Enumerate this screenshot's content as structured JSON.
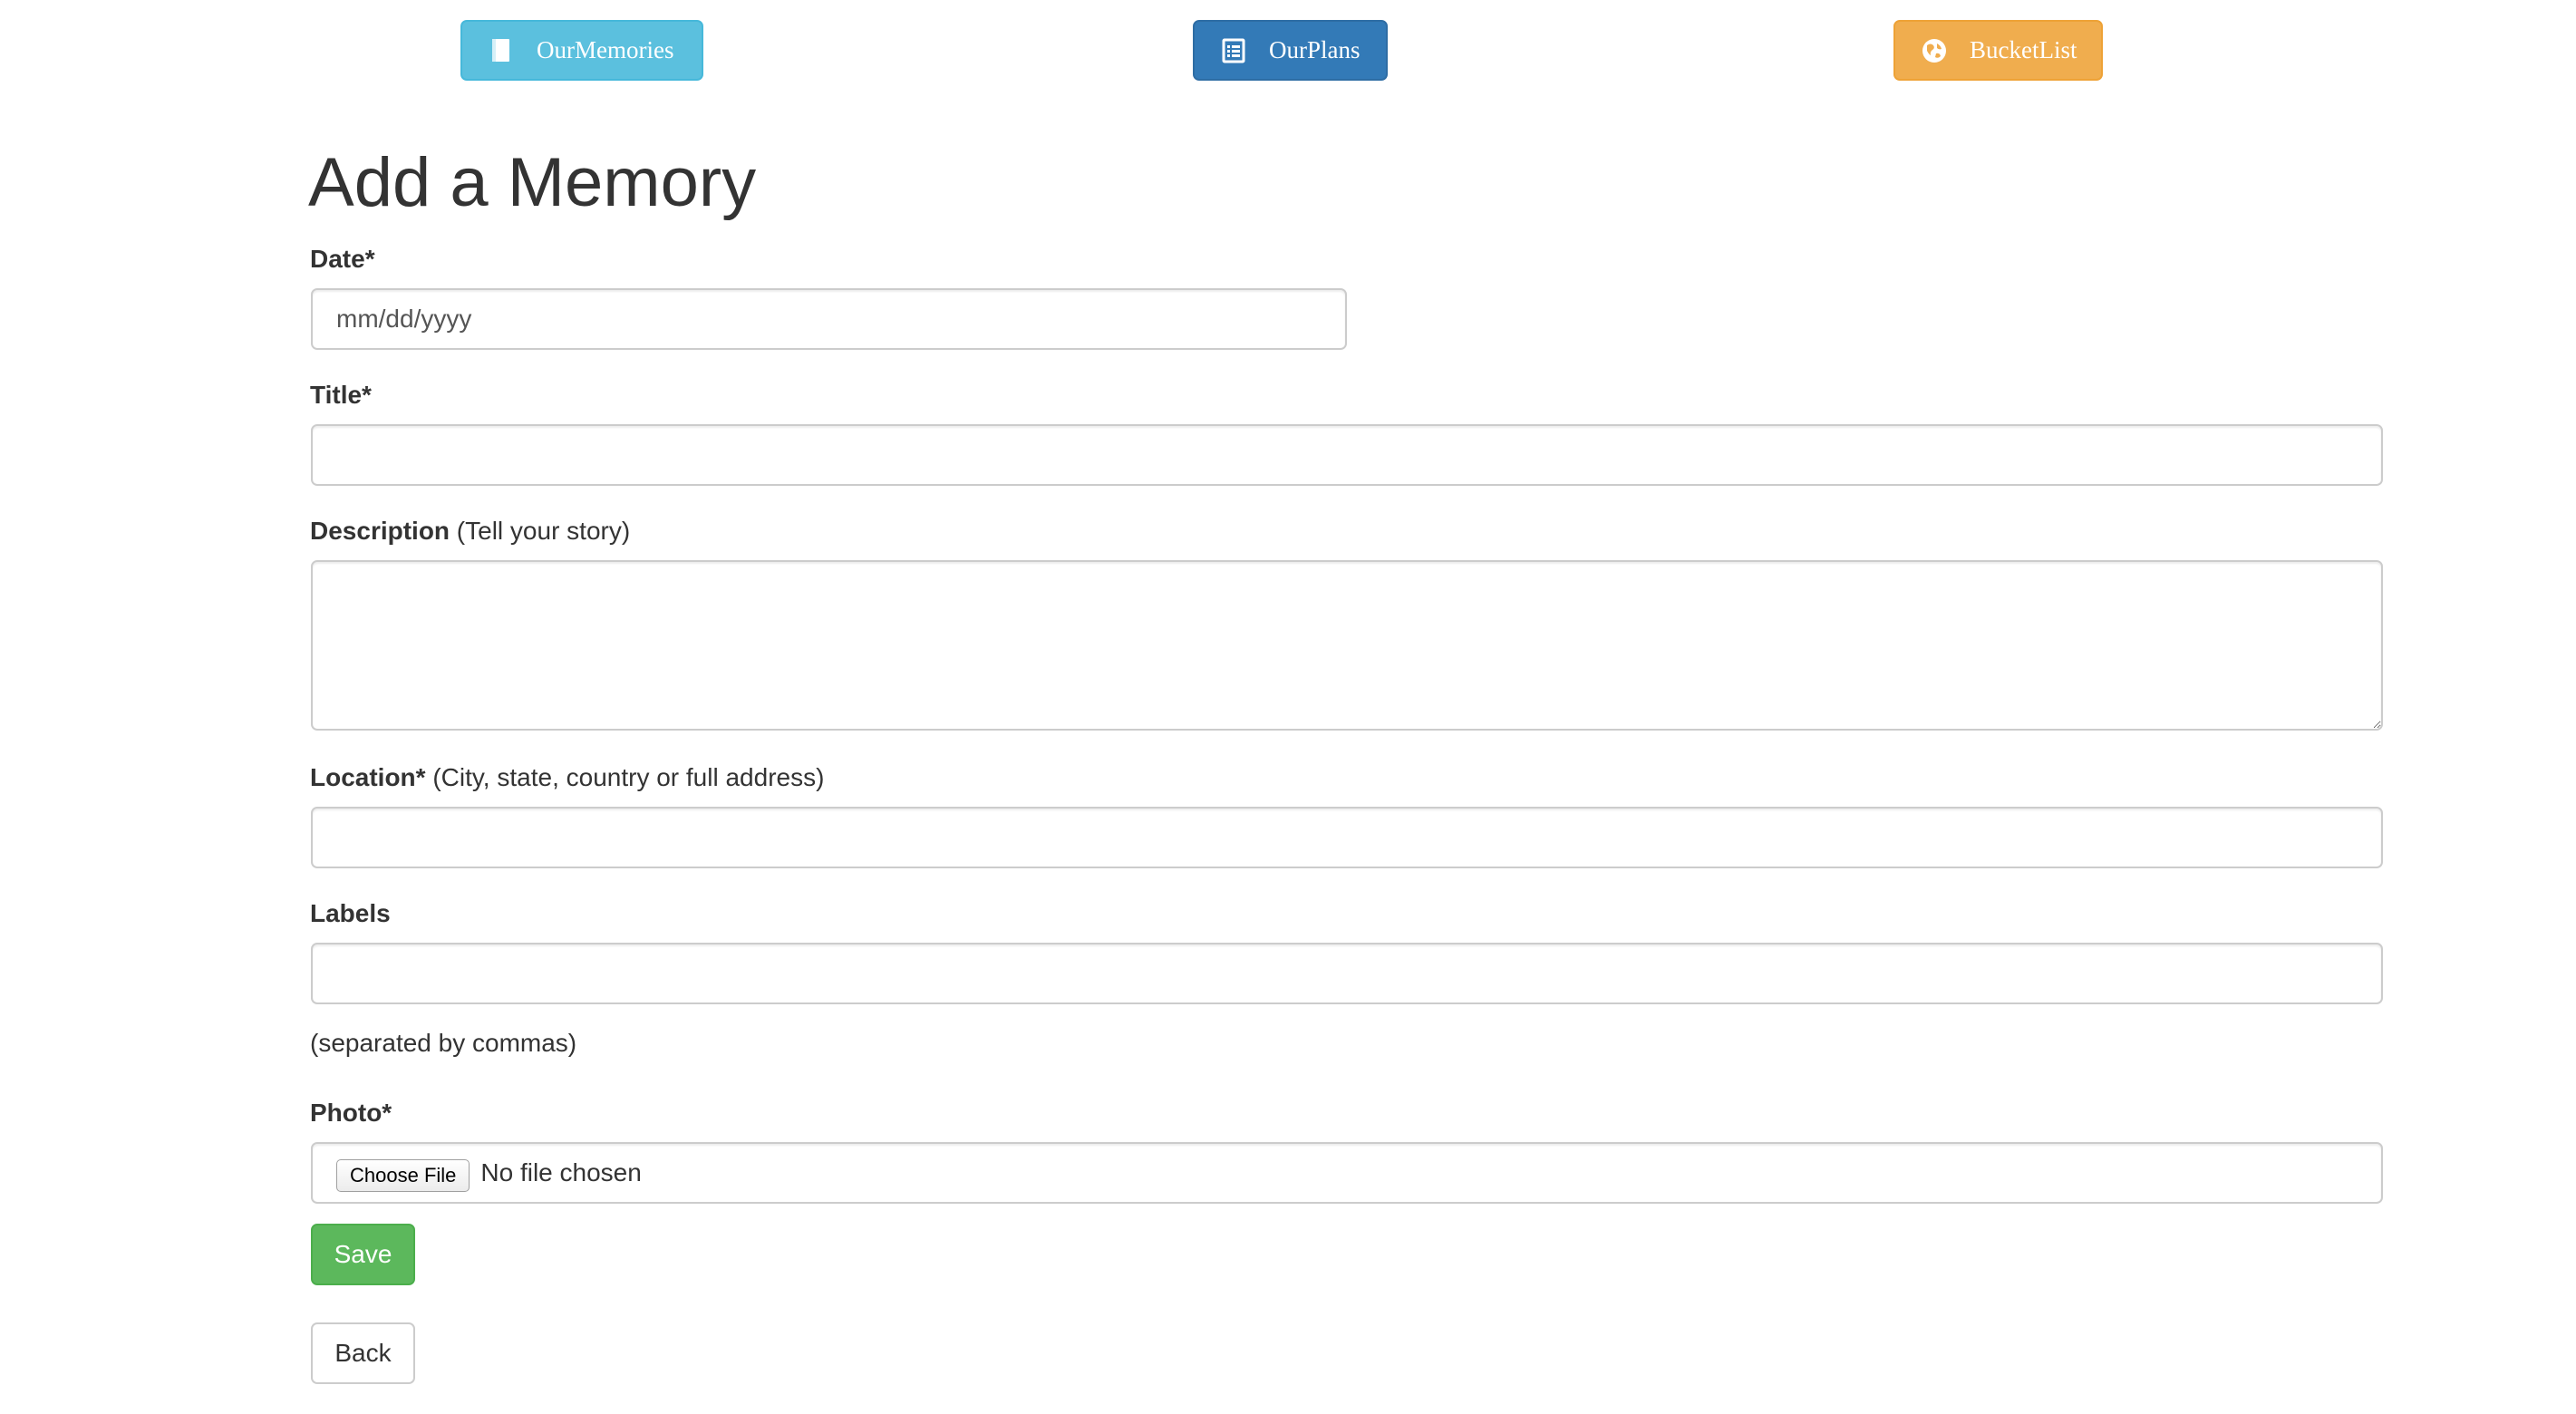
{
  "nav": {
    "memories": {
      "label": "OurMemories",
      "icon": "book-icon",
      "color": "#5bc0de"
    },
    "plans": {
      "label": "OurPlans",
      "icon": "list-alt-icon",
      "color": "#337ab7"
    },
    "bucket": {
      "label": "BucketList",
      "icon": "globe-icon",
      "color": "#f0ad4e"
    }
  },
  "page": {
    "title": "Add a Memory"
  },
  "form": {
    "date": {
      "label": "Date*",
      "placeholder": "mm/dd/yyyy",
      "value": ""
    },
    "title": {
      "label": "Title*",
      "value": ""
    },
    "description": {
      "label": "Description",
      "hint": " (Tell your story)",
      "value": ""
    },
    "location": {
      "label": "Location*",
      "hint": " (City, state, country or full address)",
      "value": ""
    },
    "labels": {
      "label": "Labels",
      "help": "(separated by commas)",
      "value": ""
    },
    "photo": {
      "label": "Photo*",
      "button": "Choose File",
      "status": "No file chosen"
    },
    "save_label": "Save",
    "back_label": "Back",
    "save_color": "#5cb85c"
  }
}
